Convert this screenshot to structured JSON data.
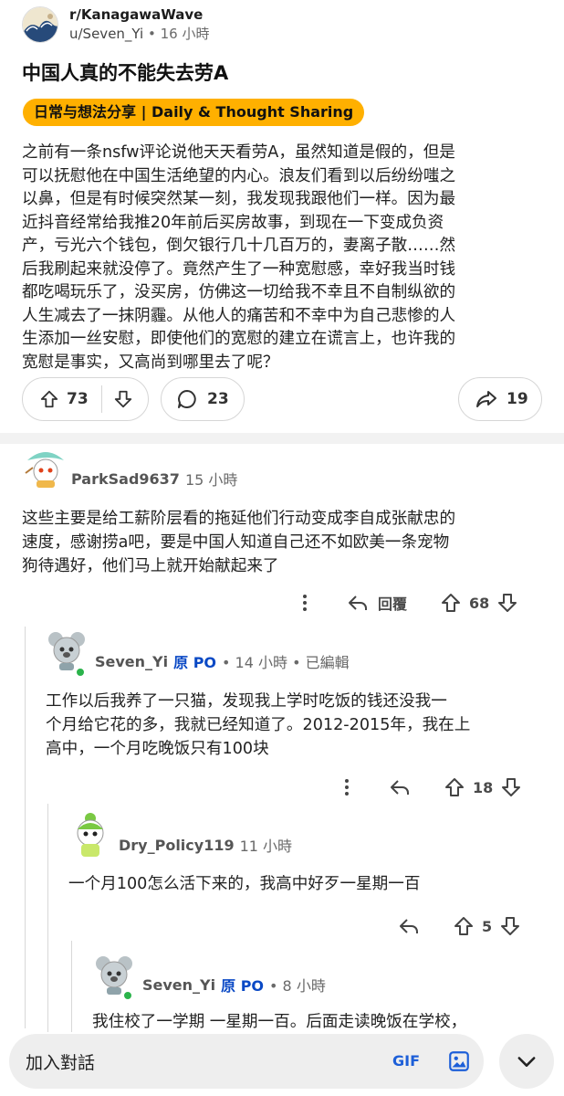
{
  "subreddit": {
    "name": "r/KanagawaWave",
    "author": "u/Seven_Yi",
    "separator": "•",
    "time": "16 小時"
  },
  "post": {
    "title": "中国人真的不能失去劳A",
    "flair": "日常与想法分享 | Daily & Thought Sharing",
    "body_lines": [
      "之前有一条nsfw评论说他天天看劳A，虽然知道是假的，但是",
      "可以抚慰他在中国生活绝望的内心。浪友们看到以后纷纷嗤之",
      "以鼻，但是有时候突然某一刻，我发现我跟他们一样。因为最",
      "近抖音经常给我推20年前后买房故事，到现在一下变成负资",
      "产，亏光六个钱包，倒欠银行几十几百万的，妻离子散……然",
      "后我刷起来就没停了。竟然产生了一种宽慰感，幸好我当时钱",
      "都吃喝玩乐了，没买房，仿佛这一切给我不幸且不自制纵欲的",
      "人生减去了一抹阴霾。从他人的痛苦和不幸中为自己悲惨的人",
      "生添加一丝安慰，即使他们的宽慰的建立在谎言上，也许我的",
      "宽慰是事实，又高尚到哪里去了呢？"
    ],
    "upvotes": "73",
    "comments": "23",
    "shares": "19"
  },
  "comments": [
    {
      "user": "ParkSad9637",
      "op": "",
      "time": "15 小時",
      "lines": [
        "这些主要是给工薪阶层看的拖延他们行动变成李自成张献忠的",
        "速度，感谢捞a吧，要是中国人知道自己还不如欧美一条宠物",
        "狗待遇好，他们马上就开始献起来了"
      ],
      "reply_label": "回覆",
      "votes": "68"
    },
    {
      "user": "Seven_Yi",
      "op": "原 PO",
      "time": "• 14 小時 • 已編輯",
      "lines": [
        "工作以后我养了一只猫，发现我上学时吃饭的钱还没我一",
        "个月给它花的多，我就已经知道了。2012-2015年，我在上",
        "高中，一个月吃晚饭只有100块"
      ],
      "votes": "18"
    },
    {
      "user": "Dry_Policy119",
      "op": "",
      "time": "11 小時",
      "lines": [
        "一个月100怎么活下来的，我高中好歹一星期一百"
      ],
      "votes": "5"
    },
    {
      "user": "Seven_Yi",
      "op": "原 PO",
      "time": "• 8 小時",
      "lines": [
        "我住校了一学期 一星期一百。后面走读晚饭在学校，"
      ],
      "votes": ""
    }
  ],
  "composer": {
    "placeholder": "加入對話",
    "gif_label": "GIF"
  },
  "colors": {
    "flair_bg": "#ffb000",
    "op_blue": "#0a49c5",
    "online_green": "#2bb34b"
  },
  "icons": [
    "upvote-icon",
    "downvote-icon",
    "comment-icon",
    "share-icon",
    "more-icon",
    "reply-icon",
    "image-icon",
    "chevron-down-icon"
  ]
}
